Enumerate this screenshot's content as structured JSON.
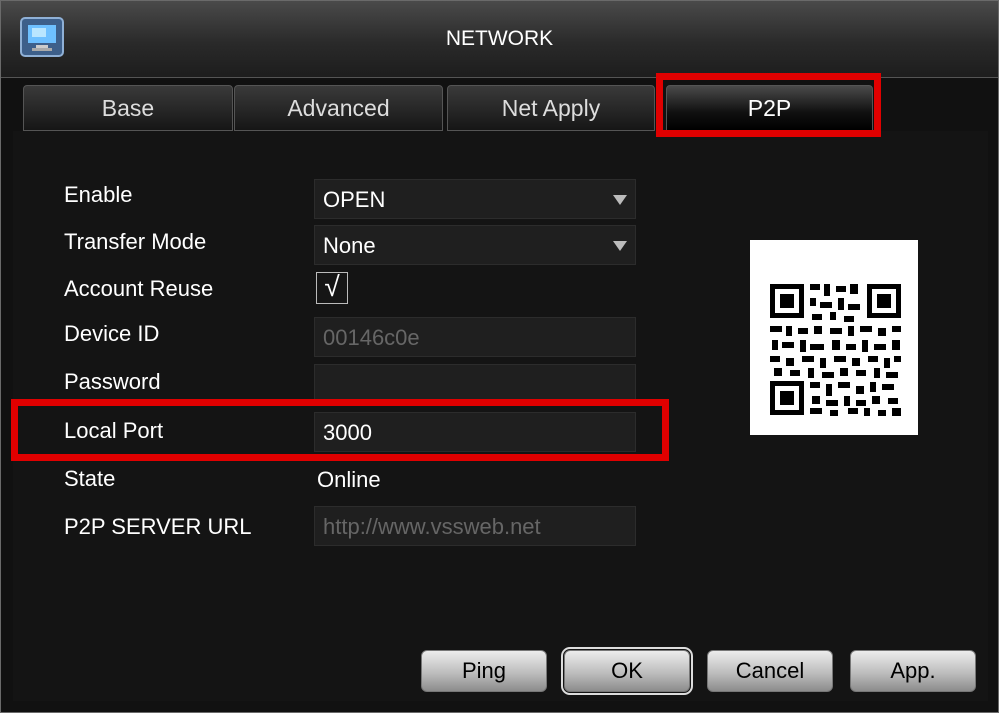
{
  "window": {
    "title": "NETWORK",
    "icon": "monitor-icon"
  },
  "tabs": [
    {
      "label": "Base"
    },
    {
      "label": "Advanced"
    },
    {
      "label": "Net Apply"
    },
    {
      "label": "P2P",
      "active": true
    }
  ],
  "form": {
    "enable": {
      "label": "Enable",
      "value": "OPEN"
    },
    "transfer_mode": {
      "label": "Transfer Mode",
      "value": "None"
    },
    "account_reuse": {
      "label": "Account Reuse",
      "checked": true,
      "check_glyph": "√"
    },
    "device_id": {
      "label": "Device ID",
      "value": "00146c0e"
    },
    "password": {
      "label": "Password",
      "value": ""
    },
    "local_port": {
      "label": "Local Port",
      "value": "3000"
    },
    "state": {
      "label": "State",
      "value": "Online"
    },
    "p2p_server_url": {
      "label": "P2P SERVER URL",
      "value": "http://www.vssweb.net"
    }
  },
  "qr": {
    "icon": "qr-code-icon"
  },
  "buttons": {
    "ping": "Ping",
    "ok": "OK",
    "cancel": "Cancel",
    "apply": "App."
  },
  "colors": {
    "highlight": "#e00000",
    "background": "#141414",
    "field": "#1f1f1f"
  }
}
